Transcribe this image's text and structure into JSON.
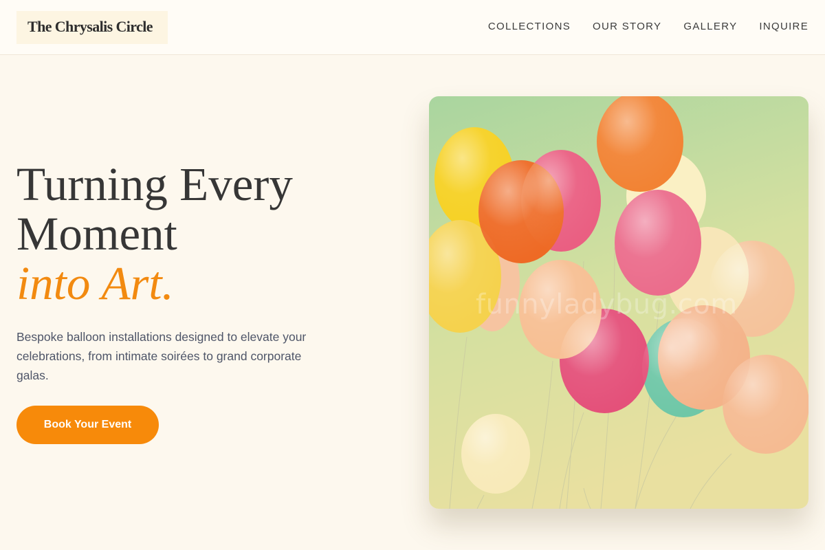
{
  "header": {
    "logo": "The Chrysalis Circle",
    "nav": [
      "COLLECTIONS",
      "OUR STORY",
      "GALLERY",
      "INQUIRE"
    ]
  },
  "hero": {
    "headline_line1": "Turning Every",
    "headline_line2": "Moment",
    "headline_accent": "into Art.",
    "description": "Bespoke balloon installations designed to elevate your celebrations, from intimate soirées to grand corporate galas.",
    "cta_label": "Book Your Event",
    "image_watermark": "funnyladybug.com"
  },
  "colors": {
    "accent": "#f78a0a",
    "background": "#fdf8ee",
    "text": "#363636"
  }
}
